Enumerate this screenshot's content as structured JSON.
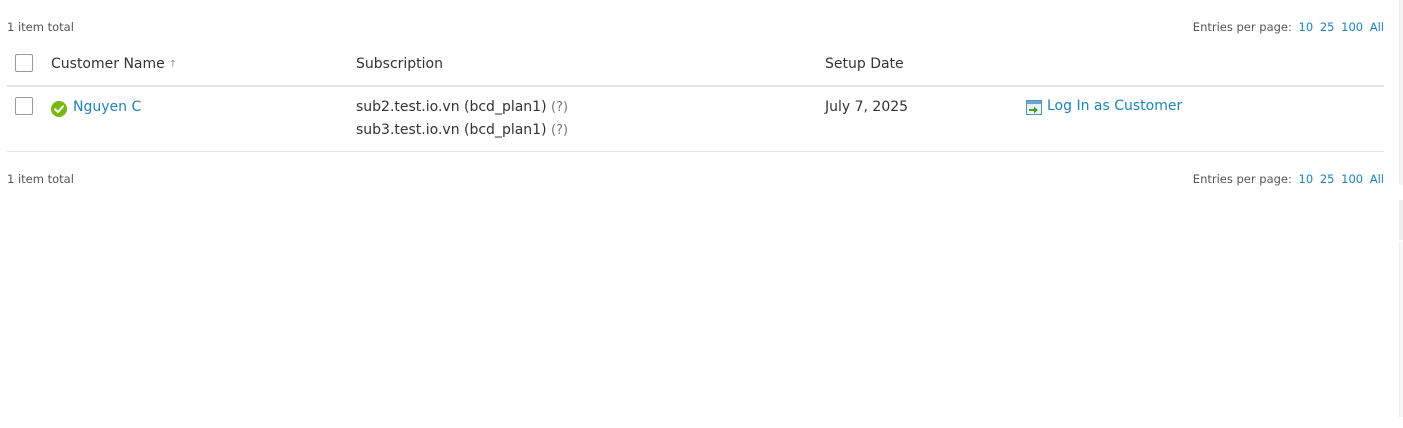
{
  "pager": {
    "total_label": "1 item total",
    "entries_label": "Entries per page:",
    "options": [
      "10",
      "25",
      "100",
      "All"
    ]
  },
  "table": {
    "columns": {
      "name": "Customer Name",
      "subscription": "Subscription",
      "setup_date": "Setup Date"
    },
    "sort_icon": "arrow-up-icon",
    "rows": [
      {
        "name": "Nguyen C",
        "status_icon": "active-check-icon",
        "subscriptions": [
          {
            "text": "sub2.test.io.vn (bcd_plan1)",
            "help": "(?)"
          },
          {
            "text": "sub3.test.io.vn (bcd_plan1)",
            "help": "(?)"
          }
        ],
        "setup_date": "July 7, 2025",
        "action_label": "Log In as Customer",
        "action_icon": "login-as-customer-icon"
      }
    ]
  },
  "colors": {
    "link": "#1d84b5",
    "status_ok": "#77b80b",
    "divider": "#e3e3e3"
  }
}
